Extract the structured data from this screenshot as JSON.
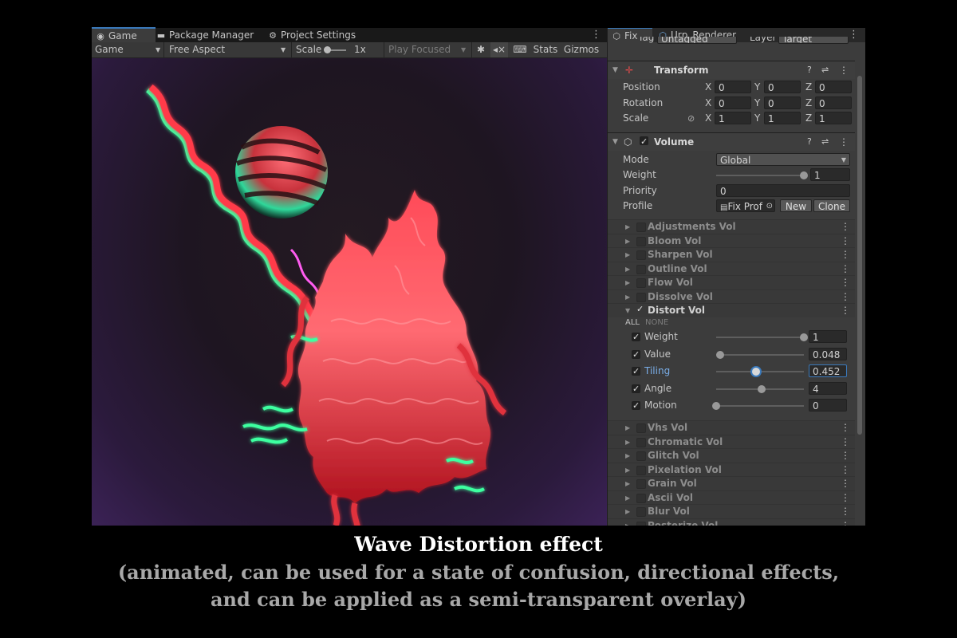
{
  "game_panel": {
    "tabs": [
      {
        "label": "Game",
        "icon": "gamepad-icon"
      },
      {
        "label": "Package Manager",
        "icon": "package-icon"
      },
      {
        "label": "Project Settings",
        "icon": "gear-icon"
      }
    ],
    "toolbar": {
      "display": "Game",
      "aspect": "Free Aspect",
      "scale_label": "Scale",
      "scale_value": "1x",
      "play_mode": "Play Focused",
      "stats": "Stats",
      "gizmos": "Gizmos"
    }
  },
  "inspector": {
    "tabs": [
      {
        "label": "Fix",
        "icon": "cube-icon"
      },
      {
        "label": "Urp_Renderer",
        "icon": "cube-icon"
      }
    ],
    "tag_label": "Tag",
    "tag_value": "Untagged",
    "layer_label": "Layer",
    "layer_value": "Target",
    "transform": {
      "title": "Transform",
      "position_label": "Position",
      "rotation_label": "Rotation",
      "scale_label": "Scale",
      "position": {
        "x": "0",
        "y": "0",
        "z": "0"
      },
      "rotation": {
        "x": "0",
        "y": "0",
        "z": "0"
      },
      "scale": {
        "x": "1",
        "y": "1",
        "z": "1"
      },
      "axis_x": "X",
      "axis_y": "Y",
      "axis_z": "Z"
    },
    "volume": {
      "title": "Volume",
      "mode_label": "Mode",
      "mode_value": "Global",
      "weight_label": "Weight",
      "weight_value": "1",
      "weight_level": 1.0,
      "priority_label": "Priority",
      "priority_value": "0",
      "profile_label": "Profile",
      "profile_value": "Fix Prof",
      "new_button": "New",
      "clone_button": "Clone"
    },
    "volumes_before": [
      "Adjustments Vol",
      "Bloom Vol",
      "Sharpen Vol",
      "Outline Vol",
      "Flow Vol",
      "Dissolve Vol"
    ],
    "distort": {
      "title": "Distort Vol",
      "all": "ALL",
      "none": "NONE",
      "params": [
        {
          "label": "Weight",
          "value": "1",
          "level": 1.0,
          "checked": true,
          "highlight": false
        },
        {
          "label": "Value",
          "value": "0.048",
          "level": 0.048,
          "checked": true,
          "highlight": false
        },
        {
          "label": "Tiling",
          "value": "0.452",
          "level": 0.452,
          "checked": true,
          "highlight": true
        },
        {
          "label": "Angle",
          "value": "4",
          "level": 0.52,
          "checked": true,
          "highlight": false
        },
        {
          "label": "Motion",
          "value": "0",
          "level": 0.0,
          "checked": true,
          "highlight": false
        }
      ]
    },
    "volumes_after": [
      "Vhs Vol",
      "Chromatic Vol",
      "Glitch Vol",
      "Pixelation Vol",
      "Grain Vol",
      "Ascii Vol",
      "Blur Vol",
      "Posterize Vol"
    ]
  },
  "caption": {
    "title": "Wave Distortion effect",
    "line1": "(animated, can be used for a state of confusion, directional effects,",
    "line2": "and can be applied as a semi-transparent overlay)"
  },
  "colors": {
    "accent": "#3a79bb",
    "effect_red": "#ff3a48",
    "effect_green": "#3cffa0"
  }
}
